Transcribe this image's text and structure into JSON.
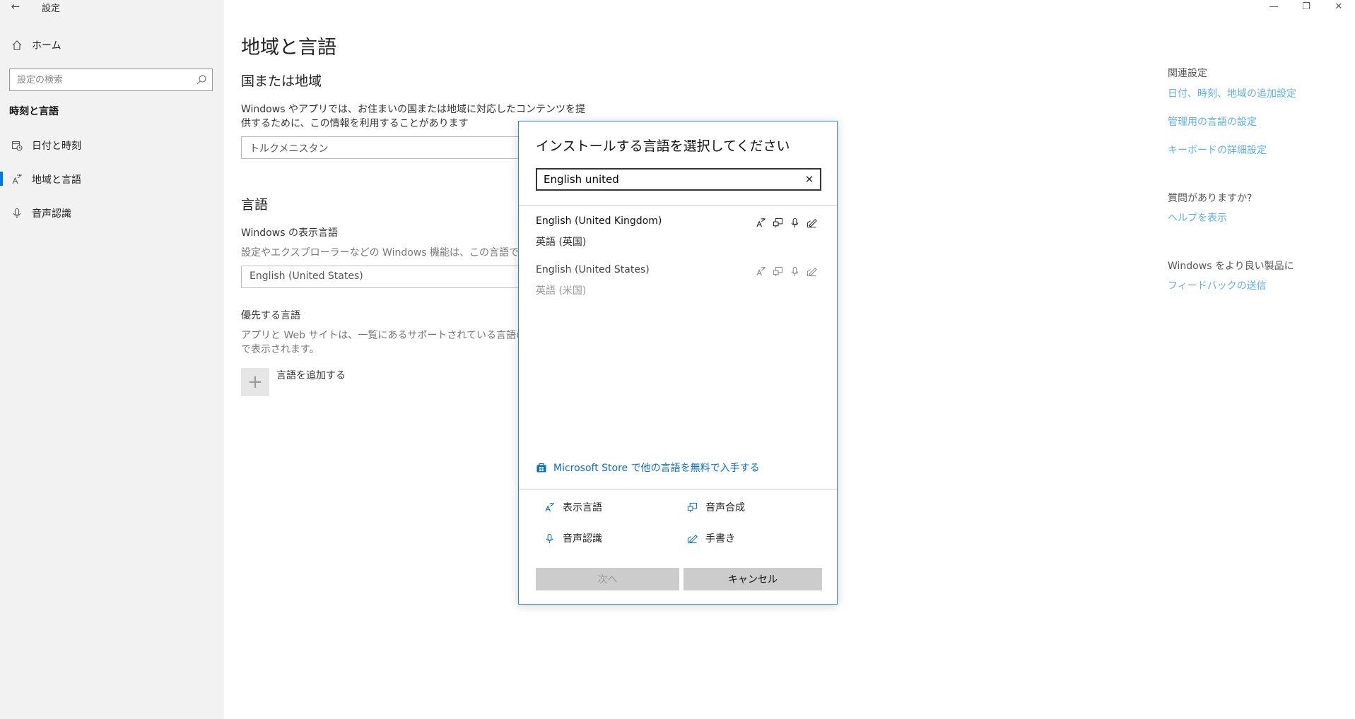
{
  "window": {
    "title": "設定",
    "back_glyph": "←",
    "minimize_glyph": "—",
    "restore_glyph": "❐",
    "close_glyph": "✕"
  },
  "sidebar": {
    "home_label": "ホーム",
    "search_placeholder": "設定の検索",
    "section_title": "時刻と言語",
    "items": [
      {
        "label": "日付と時刻",
        "icon": "calendar-clock-icon"
      },
      {
        "label": "地域と言語",
        "icon": "language-icon",
        "selected": true
      },
      {
        "label": "音声認識",
        "icon": "microphone-icon"
      }
    ]
  },
  "main": {
    "page_title": "地域と言語",
    "country": {
      "heading": "国または地域",
      "description_line1": "Windows やアプリでは、お住まいの国または地域に対応したコンテンツを提",
      "description_line2": "供するために、この情報を利用することがあります",
      "selected_value": "トルクメニスタン"
    },
    "language": {
      "heading": "言語",
      "display_language_label": "Windows の表示言語",
      "display_language_desc": "設定やエクスプローラーなどの Windows 機能は、この言語で表示さ",
      "display_language_value": "English (United States)",
      "preferred_label": "優先する言語",
      "preferred_desc_line1": "アプリと Web サイトは、一覧にあるサポートされている言語のうち",
      "preferred_desc_line2": "で表示されます。",
      "add_button_glyph": "+",
      "add_label": "言語を追加する"
    }
  },
  "related": {
    "heading": "関連設定",
    "links": [
      "日付、時刻、地域の追加設定",
      "管理用の言語の設定",
      "キーボードの詳細設定"
    ],
    "question_heading": "質問がありますか?",
    "help_link": "ヘルプを表示",
    "feedback_heading": "Windows をより良い製品に",
    "feedback_link": "フィードバックの送信"
  },
  "dialog": {
    "title": "インストールする言語を選択してください",
    "search_value": "English united",
    "clear_glyph": "✕",
    "results": [
      {
        "name": "English (United Kingdom)",
        "native": "英語 (英国)"
      },
      {
        "name": "English (United States)",
        "native": "英語 (米国)"
      }
    ],
    "store_link": "Microsoft Store で他の言語を無料で入手する",
    "legend": {
      "display": "表示言語",
      "tts": "音声合成",
      "speech": "音声認識",
      "handwriting": "手書き"
    },
    "next_label": "次へ",
    "cancel_label": "キャンセル"
  },
  "colors": {
    "accent": "#0078d7",
    "link": "#5fb0e8",
    "store_link": "#0a6fc2",
    "sidebar_bg": "#f2f2f2"
  }
}
